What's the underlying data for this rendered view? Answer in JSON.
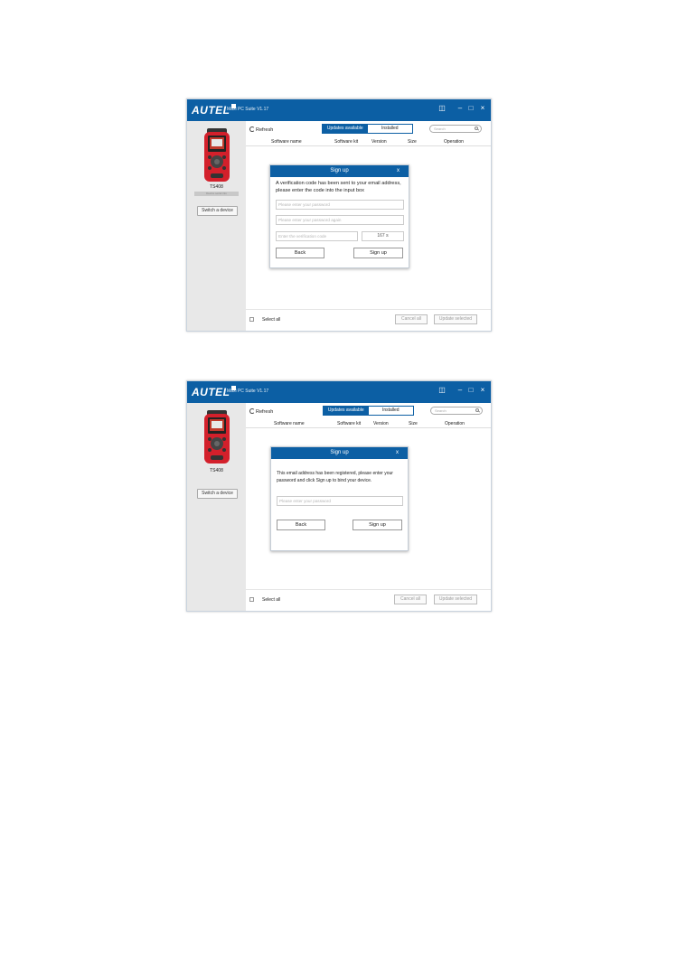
{
  "windows": [
    {
      "brand": "AUTEL",
      "app_title": "Maxi PC Suite V1.17",
      "window_controls": {
        "menu": "◫",
        "minimize": "–",
        "maximize": "□",
        "close": "×"
      },
      "device": {
        "name": "TS408",
        "subtitle": "Device serial info",
        "switch_button": "Switch a device"
      },
      "toolbar": {
        "refresh": "Refresh",
        "tabs": [
          "Updates available",
          "Installed"
        ],
        "active_tab": "Updates available",
        "search_placeholder": "Search"
      },
      "table_headers": [
        "Software name",
        "Software kit",
        "Version",
        "Size",
        "Operation"
      ],
      "footer": {
        "select_all": "Select all",
        "cancel_all": "Cancel all",
        "update_selected": "Update selected"
      },
      "dialog": {
        "title": "Sign up",
        "close": "x",
        "message": "A verification code has been sent to your email address, please enter the code into the input box",
        "fields": [
          {
            "placeholder": "Please enter your password"
          },
          {
            "placeholder": "Please enter your password again"
          },
          {
            "placeholder": "Enter the verification code"
          }
        ],
        "timer": "167 s",
        "back_button": "Back",
        "signup_button": "Sign up"
      }
    },
    {
      "brand": "AUTEL",
      "app_title": "Maxi PC Suite V1.17",
      "window_controls": {
        "menu": "◫",
        "minimize": "–",
        "maximize": "□",
        "close": "×"
      },
      "device": {
        "name": "TS408",
        "switch_button": "Switch a device"
      },
      "toolbar": {
        "refresh": "Refresh",
        "tabs": [
          "Updates available",
          "Installed"
        ],
        "active_tab": "Updates available",
        "search_placeholder": "Search"
      },
      "table_headers": [
        "Software name",
        "Software kit",
        "Version",
        "Size",
        "Operation"
      ],
      "footer": {
        "select_all": "Select all",
        "cancel_all": "Cancel all",
        "update_selected": "Update selected"
      },
      "dialog": {
        "title": "Sign up",
        "close": "x",
        "message": "This email address has been registered, please enter your password and click Sign up to bind your device.",
        "fields": [
          {
            "placeholder": "Please enter your password"
          }
        ],
        "back_button": "Back",
        "signup_button": "Sign up"
      }
    }
  ],
  "colors": {
    "accent": "#0c5fa4",
    "device_red": "#d3202b",
    "sidebar": "#e8e8e8"
  }
}
